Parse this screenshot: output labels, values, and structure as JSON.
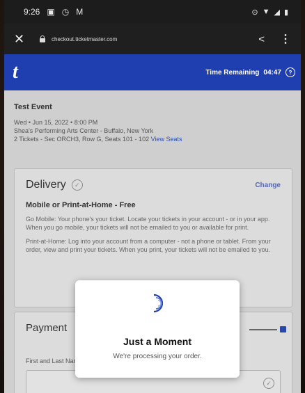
{
  "status_bar": {
    "time": "9:26",
    "indicators": [
      "msg-icon",
      "clock-icon",
      "gmail-icon"
    ]
  },
  "browser": {
    "url": "checkout.ticketmaster.com"
  },
  "header": {
    "logo": "t",
    "timer_label": "Time Remaining",
    "timer_value": "04:47"
  },
  "event": {
    "title": "Test Event",
    "date": "Wed • Jun 15, 2022 • 8:00 PM",
    "venue": "Shea's Performing Arts Center - Buffalo, New York",
    "tickets": "2 Tickets - Sec ORCH3, Row G, Seats 101 - 102",
    "view_seats": "View Seats"
  },
  "delivery": {
    "heading": "Delivery",
    "change": "Change",
    "option": "Mobile or Print-at-Home - Free",
    "mobile_text": "Go Mobile: Your phone's your ticket. Locate your tickets in your account - or in your app. When you go mobile, your tickets will not be emailed to you or available for print.",
    "print_text": "Print-at-Home: Log into your account from a computer - not a phone or tablet. From your order, view and print your tickets. When you print, your tickets will not be emailed to you."
  },
  "payment": {
    "heading": "Payment",
    "field_label": "First and Last Name"
  },
  "modal": {
    "title": "Just a Moment",
    "subtitle": "We're processing your order."
  },
  "colors": {
    "brand": "#1f3fb0",
    "overlay": "#cfcfcf",
    "link": "#2a4fb5"
  }
}
